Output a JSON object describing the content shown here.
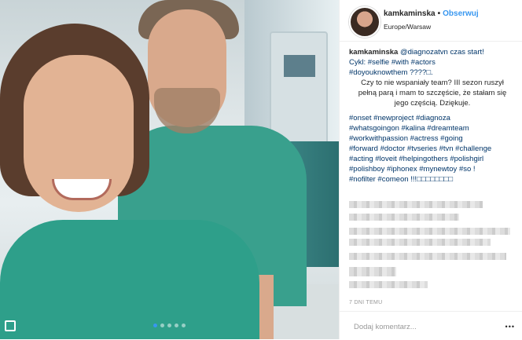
{
  "post": {
    "username": "kamkaminska",
    "follow_label": "Obserwuj",
    "separator": "•",
    "location": "Europe/Warsaw",
    "caption_lines": [
      {
        "user": "kamkaminska",
        "text": " @diagnozatvn czas start!"
      },
      {
        "text": "Cykl: #selfie #with #actors"
      },
      {
        "text": "#doyouknowthem ????□."
      },
      {
        "text": "Czy to nie wspaniały team? III sezon ruszył"
      },
      {
        "text": "pełną parą i mam to szczęście, że stałam się"
      },
      {
        "text": "jego częścią. Dziękuje."
      }
    ],
    "hashtag_lines": [
      "#onset #newproject #diagnoza",
      "#whatsgoingon #kalina #dreamteam",
      "#workwithpassion #actress #going",
      "#forward #doctor #tvseries #tvn #challenge",
      "#acting #loveit #helpingothers #polishgirl",
      "#polishboy #iphonex #mynewtoy #so !",
      "#nofilter #comeon !!!□□□□□□□□"
    ],
    "time": "7 DNI TEMU",
    "comment_placeholder": "Dodaj komentarz...",
    "more_label": "•••"
  },
  "carousel": {
    "count": 5,
    "active_index": 0
  },
  "colors": {
    "link": "#3897f0",
    "hashtag": "#003569",
    "scrubs": "#2e9f8a"
  }
}
